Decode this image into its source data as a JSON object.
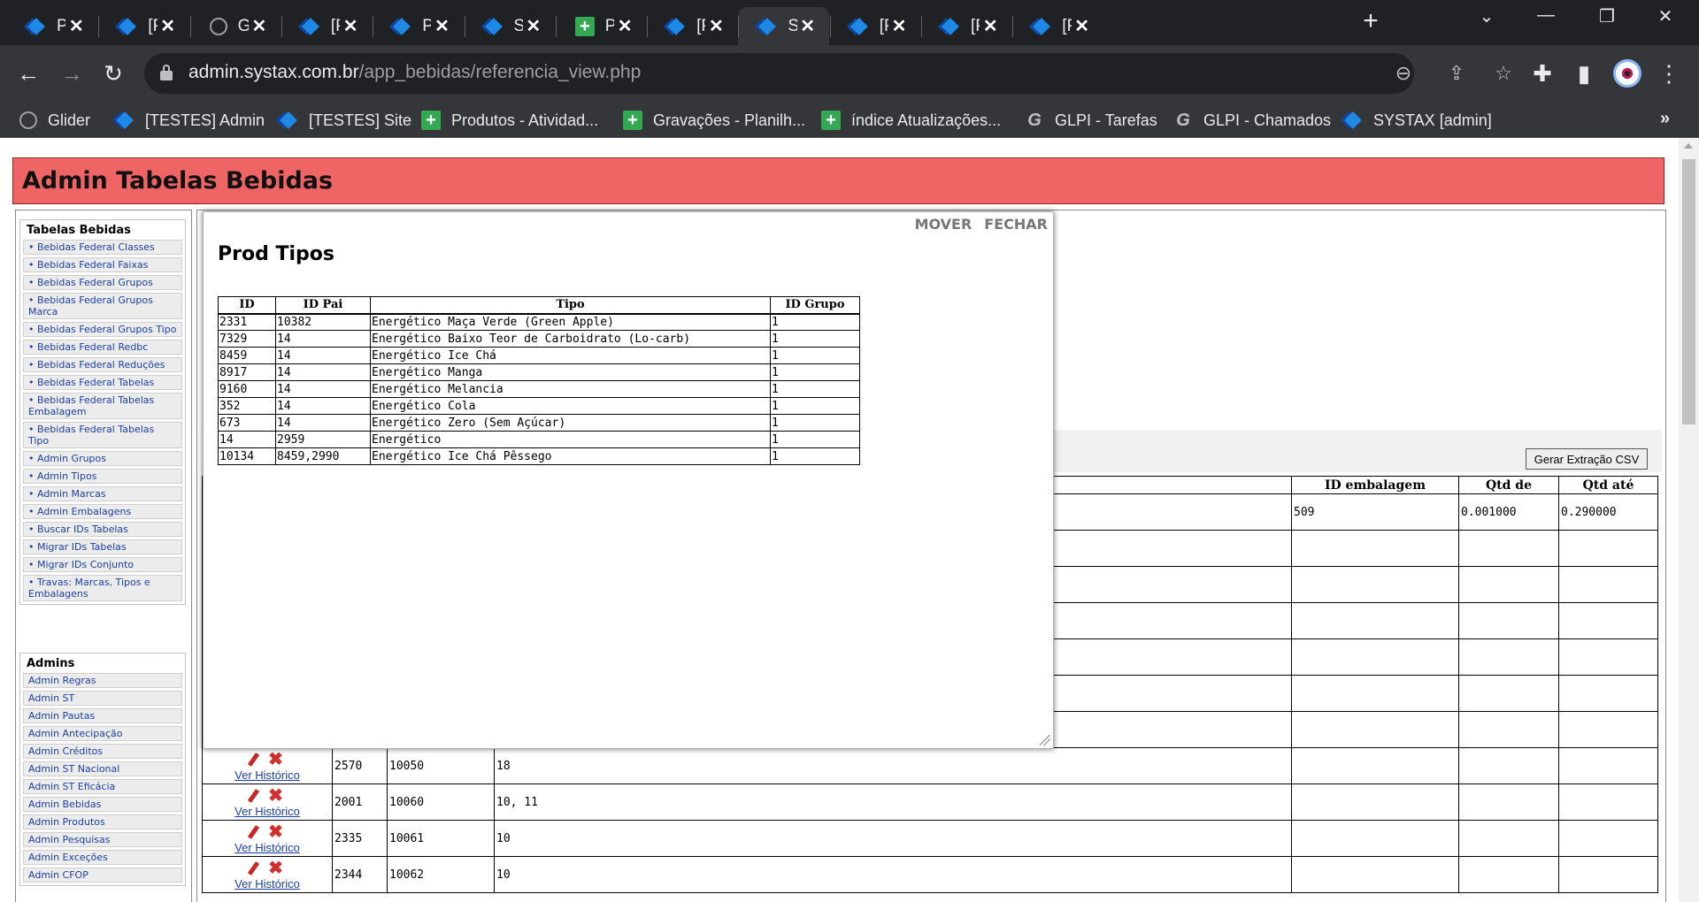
{
  "browser": {
    "tabs": [
      {
        "title": "PH",
        "icon": "diamond"
      },
      {
        "title": "[PH",
        "icon": "diamond"
      },
      {
        "title": "Glid",
        "icon": "globe"
      },
      {
        "title": "[PH",
        "icon": "diamond"
      },
      {
        "title": "Pai",
        "icon": "diamond"
      },
      {
        "title": "Sys",
        "icon": "diamond"
      },
      {
        "title": "PH",
        "icon": "green-plus"
      },
      {
        "title": "[PH",
        "icon": "diamond"
      },
      {
        "title": "SYS",
        "icon": "diamond"
      },
      {
        "title": "[PH",
        "icon": "diamond"
      },
      {
        "title": "[PH",
        "icon": "diamond"
      },
      {
        "title": "[PH",
        "icon": "diamond"
      }
    ],
    "active_tab_index": 8,
    "url_host": "admin.systax.com.br",
    "url_path": "/app_bebidas/referencia_view.php",
    "bookmarks": [
      {
        "label": "Glider",
        "icon": "globe"
      },
      {
        "label": "[TESTES] Admin",
        "icon": "diamond"
      },
      {
        "label": "[TESTES] Site",
        "icon": "diamond"
      },
      {
        "label": "Produtos - Atividad...",
        "icon": "green-plus"
      },
      {
        "label": "Gravações - Planilh...",
        "icon": "green-plus"
      },
      {
        "label": "índice Atualizações...",
        "icon": "green-plus"
      },
      {
        "label": "GLPI - Tarefas",
        "icon": "g-logo"
      },
      {
        "label": "GLPI - Chamados",
        "icon": "g-logo"
      },
      {
        "label": "SYSTAX [admin]",
        "icon": "diamond"
      }
    ],
    "bookmarks_more": "»"
  },
  "app": {
    "title": "Admin Tabelas Bebidas"
  },
  "sidebar": {
    "group1": {
      "title": "Tabelas Bebidas",
      "items": [
        "• Bebidas Federal Classes",
        "• Bebidas Federal Faixas",
        "• Bebidas Federal Grupos",
        "• Bebidas Federal Grupos Marca",
        "• Bebidas Federal Grupos Tipo",
        "• Bebidas Federal Redbc",
        "• Bebidas Federal Reduções",
        "• Bebidas Federal Tabelas",
        "• Bebidas Federal Tabelas Embalagem",
        "• Bebidas Federal Tabelas Tipo",
        "• Admin Grupos",
        "• Admin Tipos",
        "• Admin Marcas",
        "• Admin Embalagens",
        "• Buscar IDs Tabelas",
        "• Migrar IDs Tabelas",
        "• Migrar IDs Conjunto",
        "• Travas: Marcas, Tipos e Embalagens"
      ]
    },
    "group2": {
      "title": "Admins",
      "items": [
        "Admin Regras",
        "Admin ST",
        "Admin Pautas",
        "Admin Antecipação",
        "Admin Créditos",
        "Admin ST Nacional",
        "Admin ST Eficácia",
        "Admin Bebidas",
        "Admin Produtos",
        "Admin Pesquisas",
        "Admin Exceções",
        "Admin CFOP"
      ]
    }
  },
  "main": {
    "csv_button": "Gerar Extração CSV",
    "columns": [
      "",
      "",
      "",
      "",
      "ID embalagem",
      "Qtd de",
      "Qtd até"
    ],
    "first_row": {
      "id_embalagem": "509",
      "qtd_de": "0.001000",
      "qtd_ate": "0.290000"
    },
    "history_link": "Ver Histórico",
    "rows": [
      {
        "c1": "2570",
        "c2": "10050",
        "c3": "18"
      },
      {
        "c1": "2001",
        "c2": "10060",
        "c3": "10, 11"
      },
      {
        "c1": "2335",
        "c2": "10061",
        "c3": "10"
      },
      {
        "c1": "2344",
        "c2": "10062",
        "c3": "10"
      }
    ]
  },
  "popup": {
    "title": "Prod Tipos",
    "move_label": "MOVER",
    "close_label": "FECHAR",
    "columns": [
      "ID",
      "ID Pai",
      "Tipo",
      "ID Grupo"
    ],
    "rows": [
      [
        "2331",
        "10382",
        "Energético Maça Verde (Green Apple)",
        "1"
      ],
      [
        "7329",
        "14",
        "Energético Baixo Teor de Carboidrato (Lo-carb)",
        "1"
      ],
      [
        "8459",
        "14",
        "Energético Ice Chá",
        "1"
      ],
      [
        "8917",
        "14",
        "Energético Manga",
        "1"
      ],
      [
        "9160",
        "14",
        "Energético Melancia",
        "1"
      ],
      [
        "352",
        "14",
        "Energético Cola",
        "1"
      ],
      [
        "673",
        "14",
        "Energético Zero (Sem Açúcar)",
        "1"
      ],
      [
        "14",
        "2959",
        "Energético",
        "1"
      ],
      [
        "10134",
        "8459,2990",
        "Energético Ice Chá Pêssego",
        "1"
      ]
    ]
  }
}
